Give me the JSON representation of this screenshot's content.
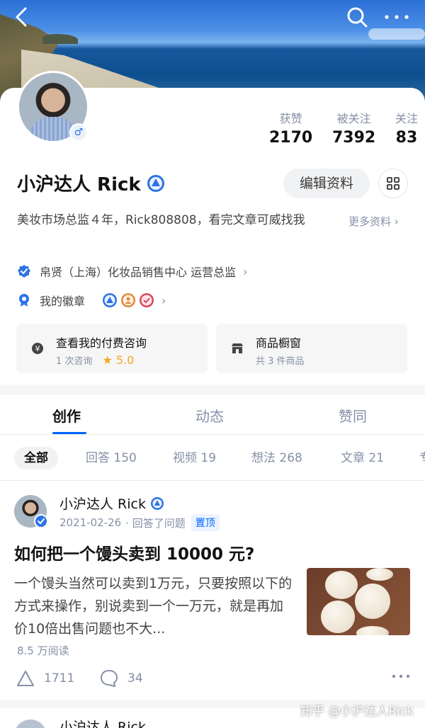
{
  "profile": {
    "name": "小沪达人 Rick",
    "gender_symbol": "♂",
    "bio": "美妆市场总监４年，Rick808808，看完文章可威找我",
    "more_info": "更多资料 ›",
    "company": "帛贤（上海）化妆品销售中心 运营总监",
    "badges_label": "我的徽章",
    "edit_button": "编辑资料"
  },
  "stats": [
    {
      "label": "获赞",
      "value": "2170"
    },
    {
      "label": "被关注",
      "value": "7392"
    },
    {
      "label": "关注",
      "value": "83"
    }
  ],
  "tiles": {
    "consult": {
      "title": "查看我的付费咨询",
      "sub": "1 次咨询",
      "rating": "★ 5.0"
    },
    "shop": {
      "title": "商品橱窗",
      "sub": "共 3 件商品"
    }
  },
  "tabs": [
    "创作",
    "动态",
    "赞同"
  ],
  "filters": [
    "全部",
    "回答 150",
    "视频 19",
    "想法 268",
    "文章 21",
    "专"
  ],
  "post": {
    "author": "小沪达人 Rick",
    "date": "2021-02-26",
    "action": "· 回答了问题",
    "pin": "置顶",
    "title": "如何把一个馒头卖到 10000 元?",
    "excerpt": "一个馒头当然可以卖到1万元，只要按照以下的方式来操作，别说卖到一个一万元，就是再加价10倍出售问题也不大...",
    "reads": "8.5 万阅读",
    "likes": "1711",
    "comments": "34"
  },
  "next_post_author": "小沪达人 Rick",
  "watermark": "知乎 @小沪达人Rick",
  "colors": {
    "accent": "#0066ff",
    "muted": "#8590a6",
    "star": "#f5a623"
  }
}
